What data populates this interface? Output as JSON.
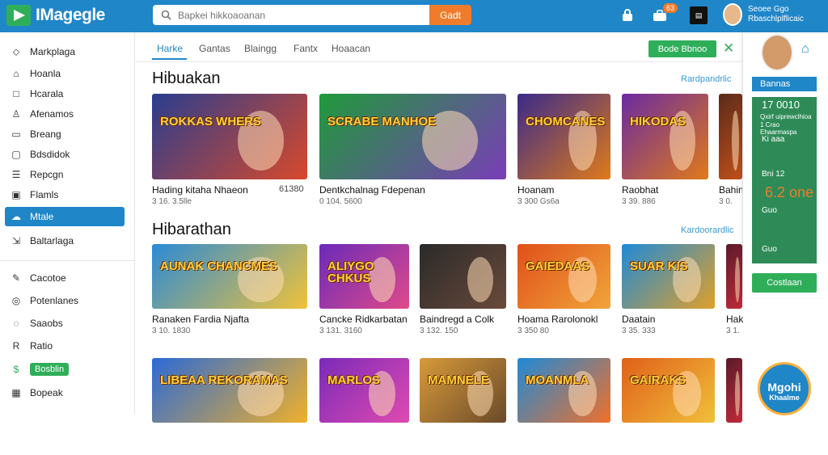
{
  "app": {
    "logo_text": "IMagegle"
  },
  "search": {
    "placeholder": "Bapkei hikkoaoanan",
    "button_label": "Gadt"
  },
  "topbar": {
    "badge": "63",
    "user_line1": "Seoee Ggo",
    "user_line2": "Rbaschlplflicaic"
  },
  "sidebar": {
    "items": [
      {
        "label": "Markplaga",
        "icon": "tag-icon"
      },
      {
        "label": "Hoanla",
        "icon": "home-icon"
      },
      {
        "label": "Hcarala",
        "icon": "square-icon"
      },
      {
        "label": "Afenamos",
        "icon": "user-icon"
      },
      {
        "label": "Breang",
        "icon": "doc-icon"
      },
      {
        "label": "Bdsdidok",
        "icon": "chat-icon"
      },
      {
        "label": "Repcgn",
        "icon": "list-icon"
      },
      {
        "label": "Flamls",
        "icon": "box-icon"
      },
      {
        "label": "Mtale",
        "icon": "cloud-icon",
        "active": true
      },
      {
        "label": "Baltarlaga",
        "icon": "arrow-icon"
      }
    ],
    "lower_items": [
      {
        "label": "Cacotoe",
        "icon": "pen-icon"
      },
      {
        "label": "Potenlanes",
        "icon": "coin-icon"
      },
      {
        "label": "Saaobs",
        "icon": "bell-icon"
      },
      {
        "label": "Ratio",
        "icon": "ra-icon"
      },
      {
        "label": "Bosblin",
        "icon": "dollar-icon",
        "pill": true
      },
      {
        "label": "Bopeak",
        "icon": "calendar-icon"
      }
    ]
  },
  "tabs": [
    "Harke",
    "Gantas",
    "Blaingg",
    "Fantx",
    "Hoaacan"
  ],
  "header_button": "Bode Bbnoo",
  "sections": [
    {
      "title": "Hibuakan",
      "link": "Rardpandrlic",
      "cards": [
        {
          "title": "Hading kitaha Nhaeon",
          "meta": "3 16. 3.5lle",
          "price": "61380",
          "art_label": "ROKKAS WHERS",
          "c1": "#2a3d8f",
          "c2": "#d8492b"
        },
        {
          "title": "Dentkchalnag Fdepenan",
          "meta": "0 104. 5600",
          "price": "",
          "art_label": "SCRABE MANHOE",
          "c1": "#1f9a3a",
          "c2": "#7a3db8"
        },
        {
          "title": "Hoanam",
          "meta": "3 300 Gs6a",
          "price": "",
          "art_label": "CHOMCANES",
          "c1": "#3a2a8a",
          "c2": "#e07a1a"
        },
        {
          "title": "Raobhat",
          "meta": "3 39. 886",
          "price": "",
          "art_label": "HIKODAS",
          "c1": "#6a2aa0",
          "c2": "#e07a1a"
        },
        {
          "title": "Bahin",
          "meta": "3 0.",
          "price": "",
          "art_label": "",
          "c1": "#5a2a1a",
          "c2": "#c0501a"
        }
      ]
    },
    {
      "title": "Hibarathan",
      "link": "Kardoorardlic",
      "cards": [
        {
          "title": "Ranaken Fardia Njafta",
          "meta": "3 10. 1830",
          "price": "",
          "art_label": "AUNAK CHANCMES",
          "c1": "#2b8ad6",
          "c2": "#f0c23a"
        },
        {
          "title": "Cancke Ridkarbatan",
          "meta": "3 131. 3160",
          "price": "",
          "art_label": "ALIYGO CHKUS",
          "c1": "#6a2ab8",
          "c2": "#e04a8a"
        },
        {
          "title": "Baindregd a Colk",
          "meta": "3 132. 150",
          "price": "",
          "art_label": "",
          "c1": "#2a2a2a",
          "c2": "#6a4a3a"
        },
        {
          "title": "Hoama Rarolonokl",
          "meta": "3 350 80",
          "price": "",
          "art_label": "GAIEDAAS",
          "c1": "#e0501a",
          "c2": "#f0a53a"
        },
        {
          "title": "Daatain",
          "meta": "3 35. 333",
          "price": "",
          "art_label": "SUAR KIS",
          "c1": "#1f8ad6",
          "c2": "#e0a02a"
        },
        {
          "title": "Hak",
          "meta": "3 1.",
          "price": "",
          "art_label": "",
          "c1": "#5a1a2a",
          "c2": "#c02a3a"
        }
      ]
    },
    {
      "title": "",
      "link": "",
      "cards": [
        {
          "title": "",
          "meta": "",
          "price": "",
          "art_label": "LIBEAA REKORAMAS",
          "c1": "#2b6ad6",
          "c2": "#f0b02a"
        },
        {
          "title": "",
          "meta": "",
          "price": "",
          "art_label": "MARLOS",
          "c1": "#7a2ab8",
          "c2": "#e04ab0"
        },
        {
          "title": "",
          "meta": "",
          "price": "",
          "art_label": "MAMNELE",
          "c1": "#d89a3a",
          "c2": "#6a4a2a"
        },
        {
          "title": "",
          "meta": "",
          "price": "",
          "art_label": "MOANMLA",
          "c1": "#1f8ad6",
          "c2": "#f0702a"
        },
        {
          "title": "",
          "meta": "",
          "price": "",
          "art_label": "GAIRAKS",
          "c1": "#e0601a",
          "c2": "#f0c03a"
        },
        {
          "title": "",
          "meta": "",
          "price": "",
          "art_label": "",
          "c1": "#5a1a2a",
          "c2": "#c02a3a"
        }
      ]
    }
  ],
  "right_panel": {
    "blue_label": "Bannas",
    "big_value": "17 0010",
    "small_1": "Qxirf uiprewclhioa",
    "small_2": "1 Crao Ehaarmaspa",
    "row_1": "Ki aaa",
    "row_2": "Bni 12",
    "price": "6.2 one",
    "row_3": "Guo",
    "row_4": "Guo",
    "button": "Costlaan"
  },
  "fab": {
    "line1": "Mgohi",
    "line2": "Khaalme"
  }
}
